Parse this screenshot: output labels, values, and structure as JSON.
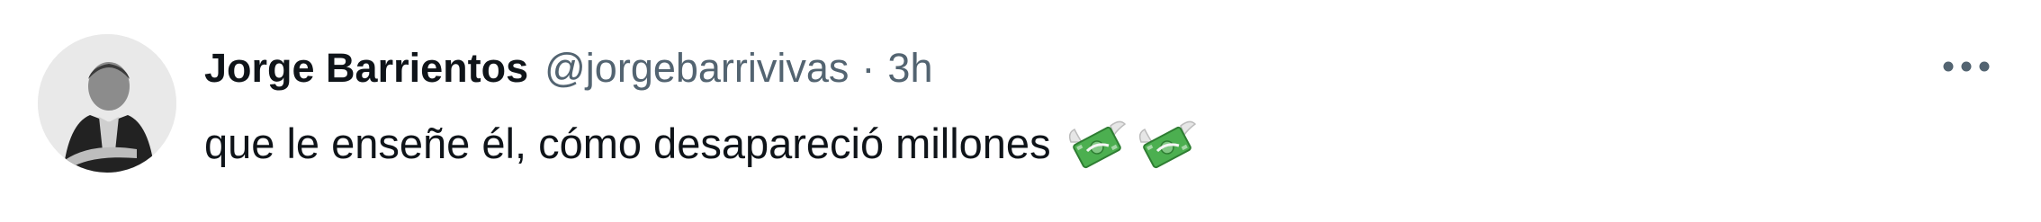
{
  "tweet": {
    "author": {
      "display_name": "Jorge Barrientos",
      "handle": "@jorgebarrivivas"
    },
    "separator": "·",
    "timestamp": "3h",
    "text": "que le enseñe él, cómo desapareció millones",
    "emojis": [
      "money-with-wings-icon",
      "money-with-wings-icon"
    ],
    "more_icon": "more-horizontal-icon",
    "colors": {
      "name": "#0f1419",
      "meta": "#536471",
      "text": "#0f1419",
      "background": "#ffffff"
    }
  }
}
